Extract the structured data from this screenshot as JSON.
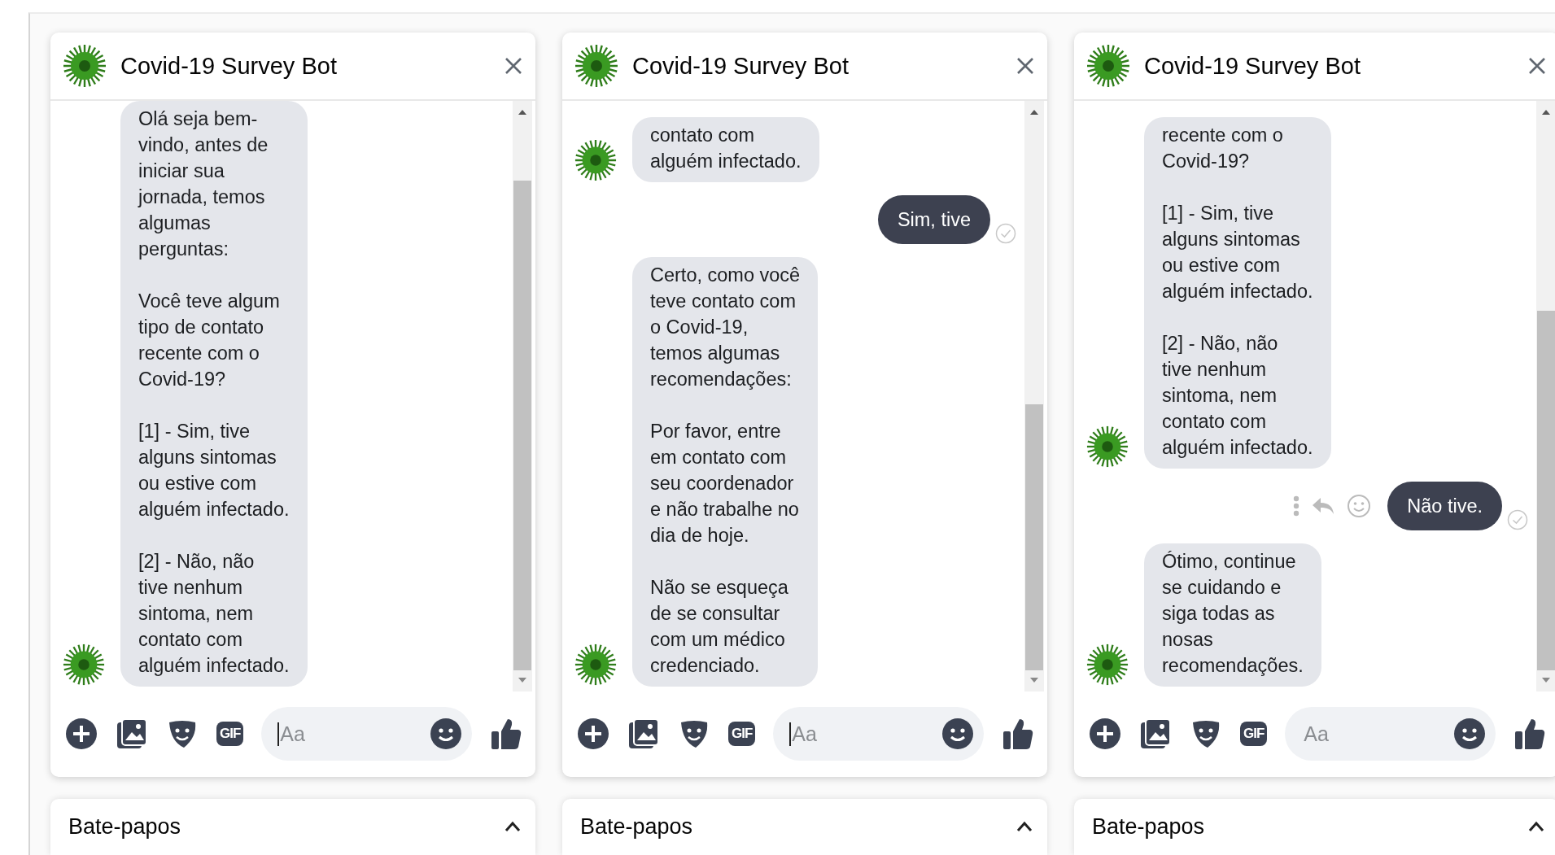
{
  "chats": [
    {
      "title": "Covid-19 Survey Bot",
      "messages": [
        {
          "kind": "bot",
          "text": "Olá seja bem-\nvindo, antes de\niniciar sua\njornada, temos\nalgumas\nperguntas:\n\nVocê teve algum\ntipo de contato\nrecente com o\nCovid-19?\n\n[1] - Sim, tive\nalguns sintomas\nou estive com\nalguém infectado.\n\n[2] - Não, não\ntive nenhum\nsintoma, nem\ncontato com\nalguém infectado."
        }
      ],
      "composer": {
        "gif_label": "GIF",
        "placeholder": "Aa",
        "focused": true
      },
      "dock": {
        "label": "Bate-papos"
      }
    },
    {
      "title": "Covid-19 Survey Bot",
      "messages": [
        {
          "kind": "bot",
          "text": "contato com\nalguém infectado."
        },
        {
          "kind": "user",
          "text": "Sim, tive",
          "seen": true,
          "show_actions": false
        },
        {
          "kind": "bot",
          "text": "Certo, como você\nteve contato com\no Covid-19,\ntemos algumas\nrecomendações:\n\nPor favor, entre\nem contato com\nseu coordenador\ne não trabalhe no\ndia de hoje.\n\nNão se esqueça\nde se consultar\ncom um médico\ncredenciado."
        }
      ],
      "composer": {
        "gif_label": "GIF",
        "placeholder": "Aa",
        "focused": true
      },
      "dock": {
        "label": "Bate-papos"
      }
    },
    {
      "title": "Covid-19 Survey Bot",
      "messages": [
        {
          "kind": "bot",
          "text": "recente com o\nCovid-19?\n\n[1] - Sim, tive\nalguns sintomas\nou estive com\nalguém infectado.\n\n[2] - Não, não\ntive nenhum\nsintoma, nem\ncontato com\nalguém infectado."
        },
        {
          "kind": "user",
          "text": "Não tive.",
          "seen": true,
          "show_actions": true
        },
        {
          "kind": "bot",
          "text": "Ótimo, continue\nse cuidando e\nsiga todas as\nnosas\nrecomendações."
        }
      ],
      "composer": {
        "gif_label": "GIF",
        "placeholder": "Aa",
        "focused": false
      },
      "dock": {
        "label": "Bate-papos"
      }
    }
  ]
}
